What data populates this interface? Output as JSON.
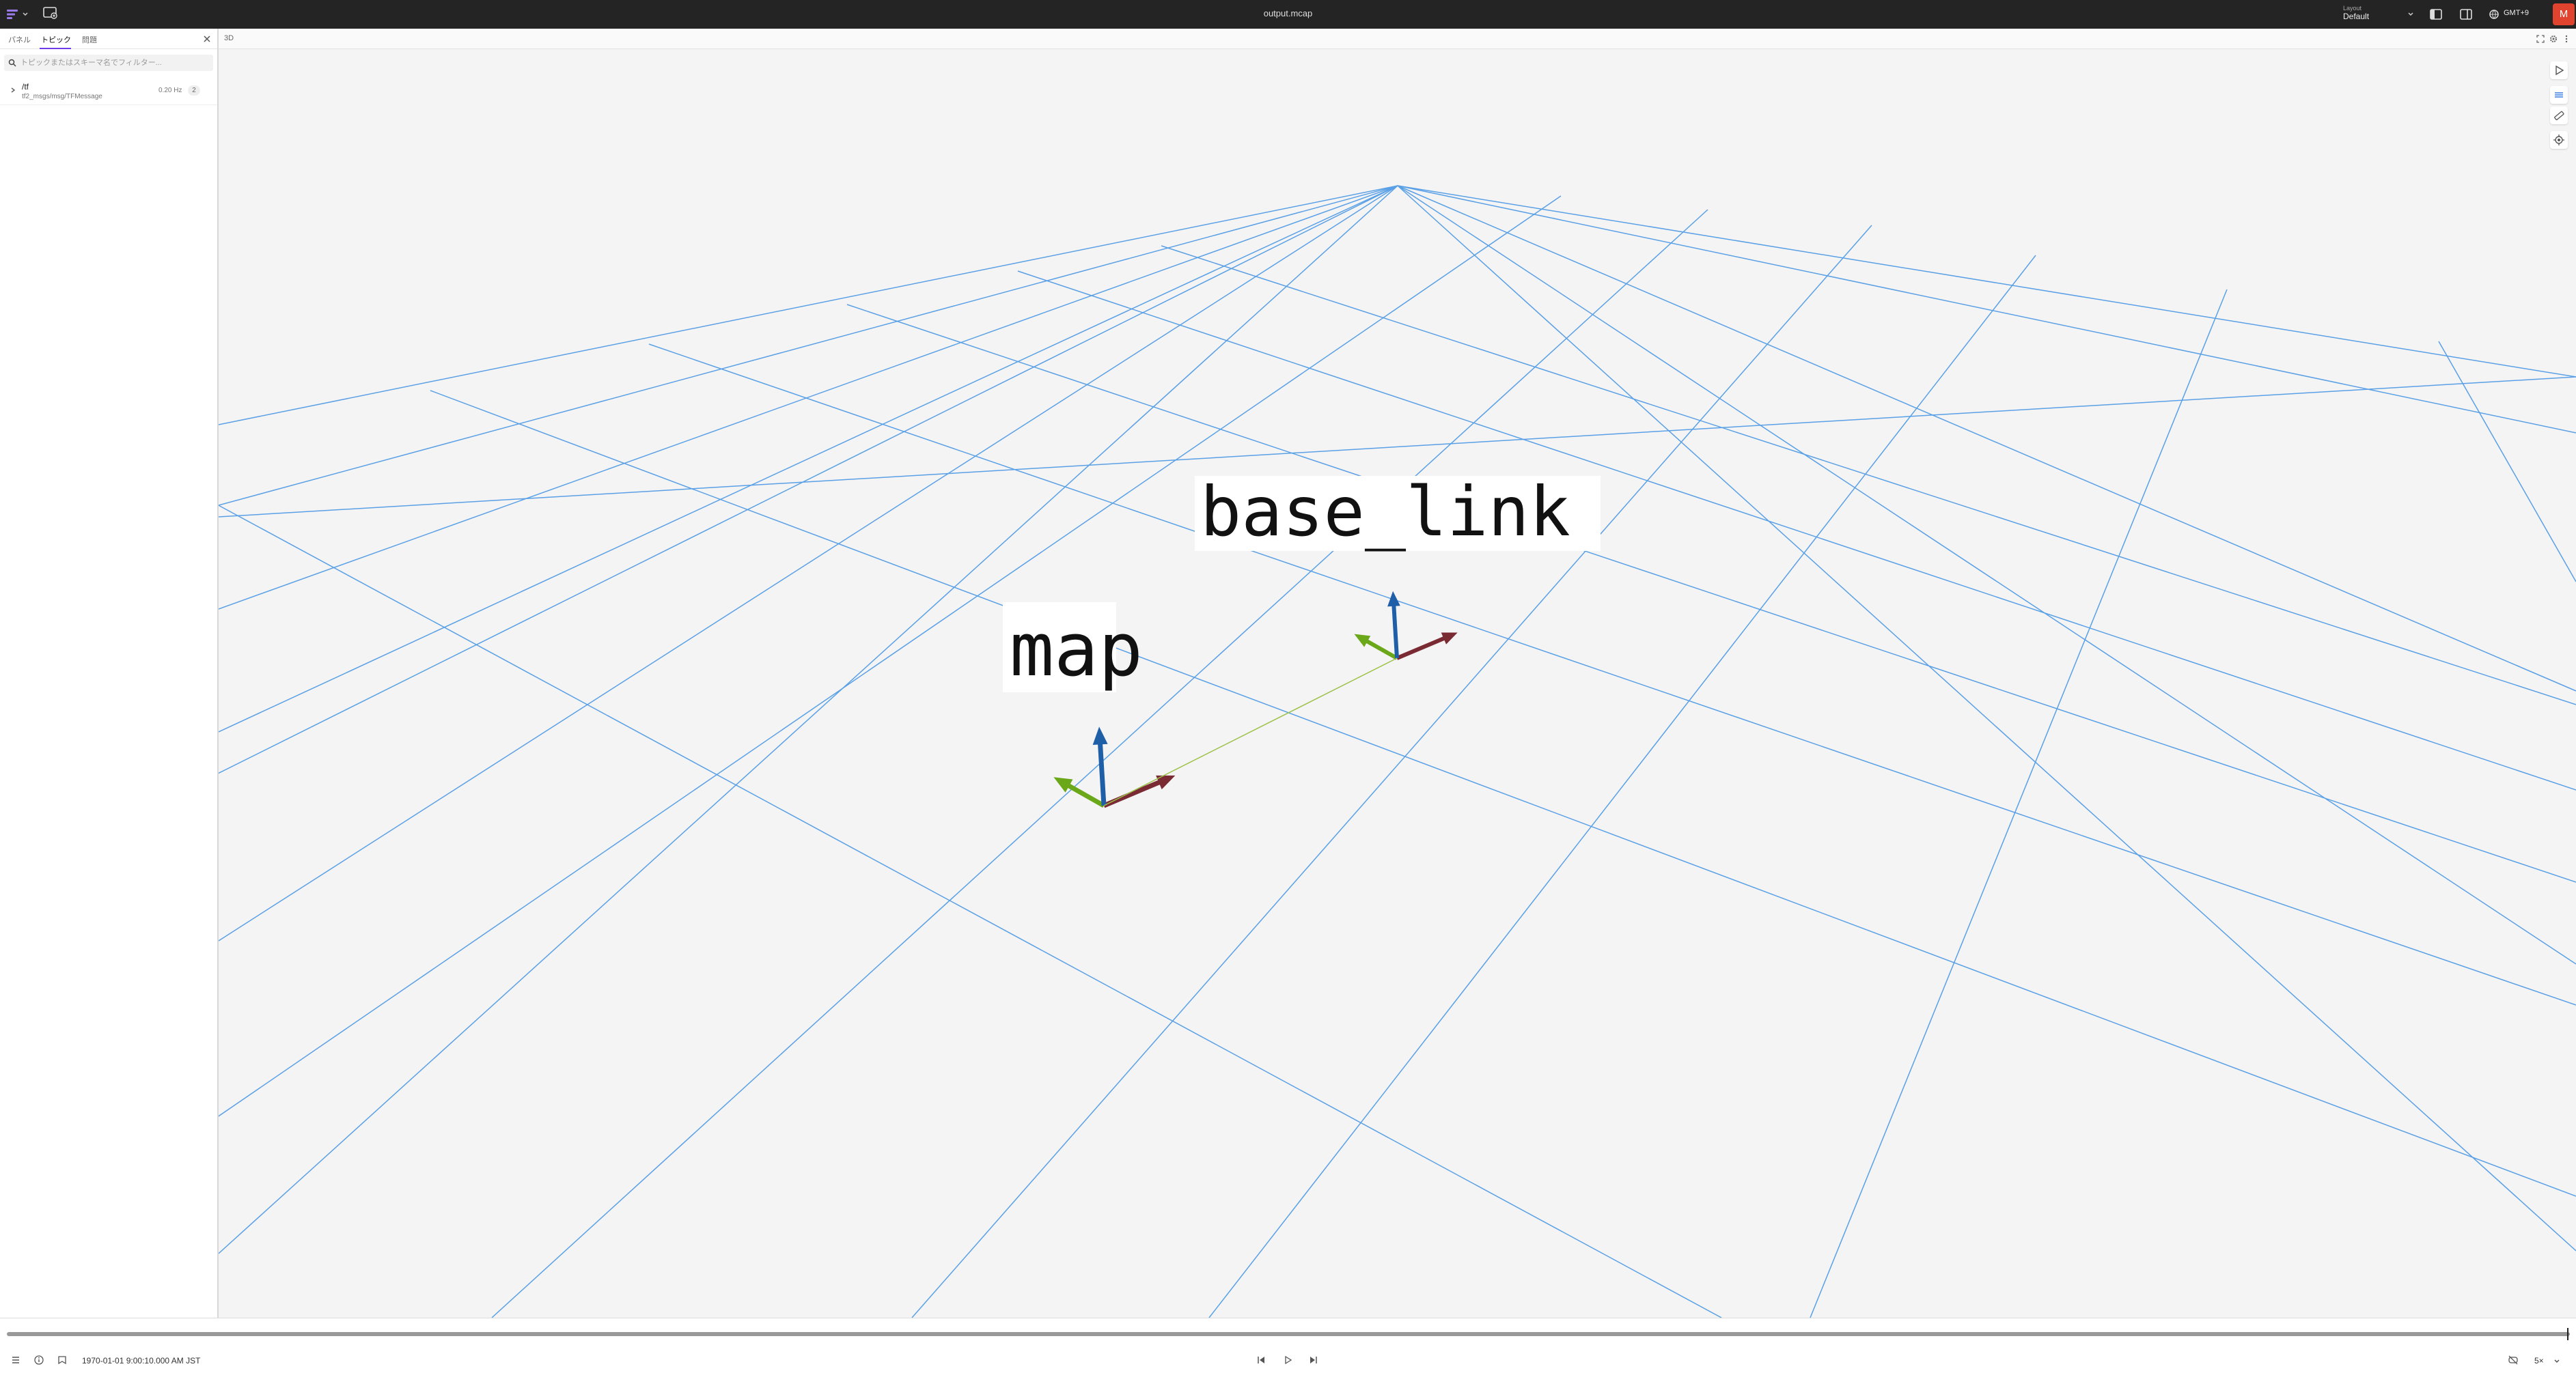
{
  "app": {
    "file_title": "output.mcap"
  },
  "layout": {
    "label": "Layout",
    "value": "Default"
  },
  "timezone": "GMT+9",
  "user": {
    "initial": "M"
  },
  "sidebar": {
    "tabs": [
      {
        "label": "パネル"
      },
      {
        "label": "トピック"
      },
      {
        "label": "問題"
      }
    ],
    "search_placeholder": "トピックまたはスキーマ名でフィルター...",
    "topics": [
      {
        "name": "/tf",
        "schema": "tf2_msgs/msg/TFMessage",
        "hz": "0.20 Hz",
        "count": "2"
      }
    ]
  },
  "panel": {
    "title": "3D"
  },
  "scene": {
    "frames": [
      {
        "label": "map"
      },
      {
        "label": "base_link"
      }
    ],
    "grid_color": "#5aa0e6",
    "axis_colors": {
      "x": "#7a2a33",
      "y": "#6aa81a",
      "z": "#1f5fa8"
    }
  },
  "playback": {
    "time": "1970-01-01 9:00:10.000 AM JST",
    "speed": "5×"
  },
  "icons": [
    "app-logo-icon",
    "new-window-icon",
    "chevron-down-icon",
    "left-sidebar-icon",
    "right-sidebar-icon",
    "globe-icon",
    "close-icon",
    "search-icon",
    "chevron-right-icon",
    "fullscreen-icon",
    "settings-icon",
    "more-icon",
    "select-tool-icon",
    "layers-icon",
    "ruler-icon",
    "crosshair-icon",
    "list-icon",
    "info-icon",
    "bookmark-icon",
    "skip-back-icon",
    "play-icon",
    "skip-forward-icon",
    "loop-icon"
  ]
}
